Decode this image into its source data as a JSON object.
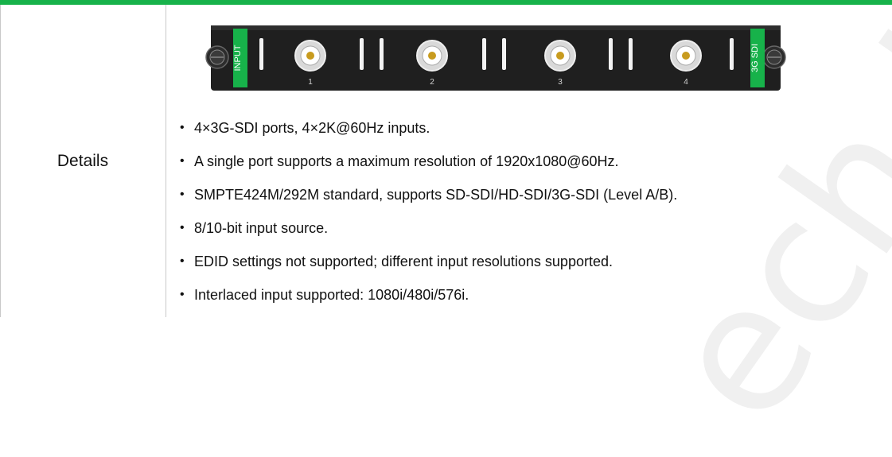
{
  "section": {
    "label": "Details",
    "panel": {
      "left_tab": "INPUT",
      "right_tab": "3G SDI",
      "ports": [
        "1",
        "2",
        "3",
        "4"
      ]
    },
    "bullets": [
      "4×3G-SDI ports, 4×2K@60Hz inputs.",
      "A single port supports a maximum resolution of 1920x1080@60Hz.",
      "SMPTE424M/292M standard, supports SD-SDI/HD-SDI/3G-SDI (Level A/B).",
      "8/10-bit input source.",
      "EDID settings not supported; different input resolutions supported.",
      "Interlaced input supported: 1080i/480i/576i."
    ]
  },
  "watermark_text": "ech Ltd",
  "colors": {
    "accent": "#17b24a",
    "panel": "#1f1f1f",
    "rule": "#c9c9c9"
  }
}
